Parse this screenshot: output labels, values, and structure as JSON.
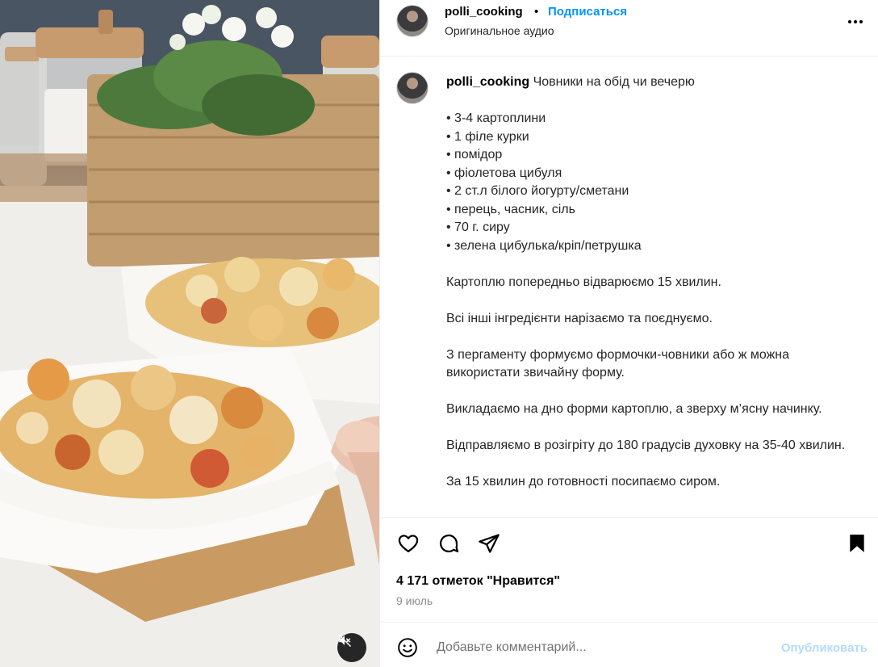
{
  "post": {
    "username": "polli_cooking",
    "separator": "•",
    "follow_label": "Подписаться",
    "audio_label": "Оригинальное аудио",
    "more_icon": "more-horizontal-icon"
  },
  "caption": {
    "username": "polli_cooking",
    "title": "Човники на обід чи вечерю",
    "ingredients": [
      "• 3-4 картоплини",
      "• 1 філе курки",
      "• помідор",
      "• фіолетова цибуля",
      "• 2 ст.л білого йогурту/сметани",
      "• перець, часник, сіль",
      "• 70 г. сиру",
      "• зелена цибулька/кріп/петрушка"
    ],
    "steps": [
      "Картоплю попередньо відварюємо 15 хвилин.",
      "Всі інші інгредієнти нарізаємо та поєднуємо.",
      "З пергаменту формуємо формочки-човники або ж можна використати звичайну форму.",
      "Викладаємо на дно форми картоплю, а зверху м’ясну начинку.",
      "Відправляємо в розігріту до 180 градусів духовку на 35-40 хвилин.",
      "За 15 хвилин до готовності посипаємо сиром."
    ]
  },
  "actions": {
    "like_icon": "heart-icon",
    "comment_icon": "comment-icon",
    "share_icon": "share-icon",
    "save_icon": "bookmark-icon",
    "likes_text": "4 171 отметок \"Нравится\"",
    "date_text": "9 июль"
  },
  "comment": {
    "emoji_icon": "emoji-icon",
    "placeholder": "Добавьте комментарий...",
    "publish_label": "Опубликовать"
  },
  "media": {
    "mute_icon": "speaker-muted-icon"
  },
  "colors": {
    "accent": "#0095f6",
    "publish_disabled": "#b3dbff",
    "divider": "#efefef",
    "muted_text": "#8e8e8e"
  }
}
